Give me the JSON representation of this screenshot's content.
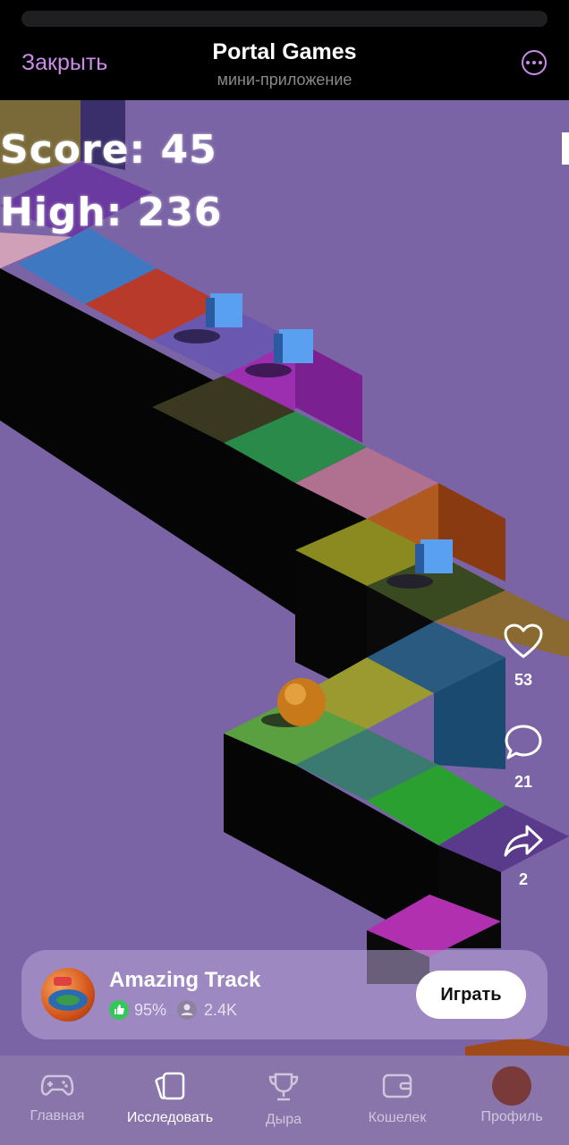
{
  "header": {
    "close_label": "Закрыть",
    "title": "Portal Games",
    "subtitle": "мини-приложение"
  },
  "game": {
    "score_text": "Score: 45",
    "high_text": "High: 236"
  },
  "side_actions": {
    "likes": "53",
    "comments": "21",
    "shares": "2"
  },
  "promo": {
    "title": "Amazing Track",
    "rating": "95%",
    "players": "2.4K",
    "play_label": "Играть"
  },
  "tabbar": {
    "items": [
      {
        "label": "Главная",
        "icon": "gamepad-icon"
      },
      {
        "label": "Исследовать",
        "icon": "cards-icon"
      },
      {
        "label": "Дыра",
        "icon": "trophy-icon"
      },
      {
        "label": "Кошелек",
        "icon": "wallet-icon"
      },
      {
        "label": "Профиль",
        "icon": "avatar"
      }
    ],
    "active_index": 1
  },
  "colors": {
    "accent": "#c98ce8",
    "game_background": "#7b64a6"
  }
}
